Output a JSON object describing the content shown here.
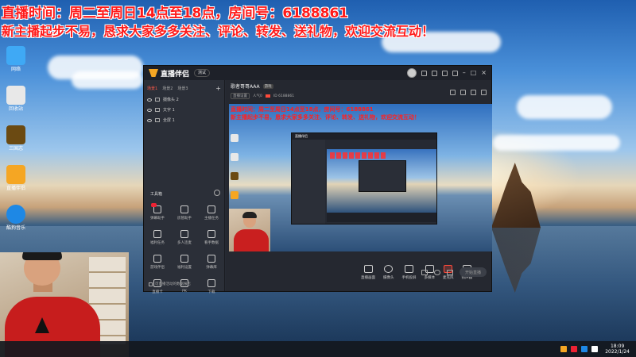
{
  "banner": {
    "line1": "直播时间：周二至周日14点至18点，房间号：6188861",
    "line2": "新主播起步不易，恳求大家多多关注、评论、转发、送礼物，欢迎交流互动！"
  },
  "desktop_icons": [
    {
      "label": "网络",
      "color": "#3fa9f5",
      "icon": "network-icon"
    },
    {
      "label": "回收站",
      "color": "#e8e8e8",
      "icon": "recycle-bin-icon"
    },
    {
      "label": "三国志",
      "color": "#b8860b",
      "icon": "game-icon"
    },
    {
      "label": "直播伴侣",
      "color": "#f5a623",
      "icon": "live-companion-icon"
    },
    {
      "label": "酷狗音乐",
      "color": "#1e88e5",
      "icon": "kugou-icon"
    }
  ],
  "window": {
    "app_name": "直播伴侣",
    "version_badge": "测试",
    "left_tabs": [
      "场景1",
      "场景2",
      "场景3"
    ],
    "sources": [
      {
        "label": "摄像头 2"
      },
      {
        "label": "文字 1"
      },
      {
        "label": "全屏 1"
      }
    ],
    "tools_header": "工具箱",
    "tools": [
      {
        "label": "弹幕助手"
      },
      {
        "label": "房管助手"
      },
      {
        "label": "主播任务"
      },
      {
        "label": "福利任务"
      },
      {
        "label": "多人连麦"
      },
      {
        "label": "看手数据"
      },
      {
        "label": "游戏伴侣"
      },
      {
        "label": "福利设置"
      },
      {
        "label": "弹幕库"
      },
      {
        "label": "直播卡"
      },
      {
        "label": "PK"
      },
      {
        "label": "下载"
      }
    ],
    "left_footer": "可直播活动的数据报告",
    "room": {
      "title": "歌者哥哥AAA",
      "tag": "游戏",
      "meta": [
        "直播设置",
        "人气0",
        "ID 6188861"
      ]
    },
    "preview_banner_line1": "直播时间：周二至周日14点至18点，房间号：6188861",
    "preview_banner_line2": "新主播起步不易，恳求大家多多关注、评论、转发、送礼物，欢迎交流互动！",
    "bottom_tools": [
      {
        "label": "直播画面",
        "icon": "screen-icon"
      },
      {
        "label": "摄像头",
        "icon": "camera-icon"
      },
      {
        "label": "手机投屏",
        "icon": "phone-cast-icon"
      },
      {
        "label": "多媒体",
        "icon": "media-icon"
      },
      {
        "label": "麦克风",
        "icon": "microphone-icon"
      },
      {
        "label": "扬声器",
        "icon": "speaker-icon"
      }
    ],
    "start_button": "开始直播"
  },
  "taskbar": {
    "time": "18:09",
    "date": "2022/1/24",
    "tray_icons": [
      {
        "icon": "app-tray-icon",
        "color": "#f5a623"
      },
      {
        "icon": "app-tray-icon",
        "color": "#e23"
      },
      {
        "icon": "app-tray-icon",
        "color": "#1e88e5"
      },
      {
        "icon": "app-tray-icon",
        "color": "#fff"
      }
    ]
  }
}
